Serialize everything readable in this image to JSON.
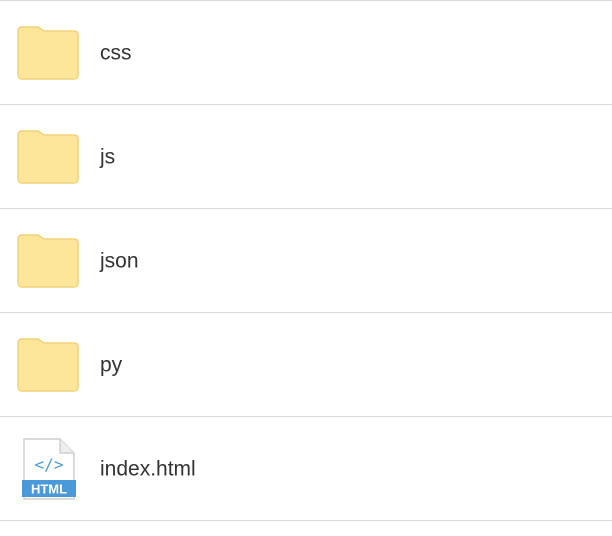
{
  "files": [
    {
      "name": "css",
      "type": "folder",
      "icon": "folder-icon"
    },
    {
      "name": "js",
      "type": "folder",
      "icon": "folder-icon"
    },
    {
      "name": "json",
      "type": "folder",
      "icon": "folder-icon"
    },
    {
      "name": "py",
      "type": "folder",
      "icon": "folder-icon"
    },
    {
      "name": "index.html",
      "type": "html",
      "icon": "html-file-icon",
      "badge": "HTML",
      "glyph": "</>"
    }
  ],
  "colors": {
    "folder_fill": "#fde69a",
    "folder_stroke": "#f0d27a",
    "html_blue": "#4a9ad9",
    "divider": "#d9d9d9",
    "text": "#333333"
  }
}
